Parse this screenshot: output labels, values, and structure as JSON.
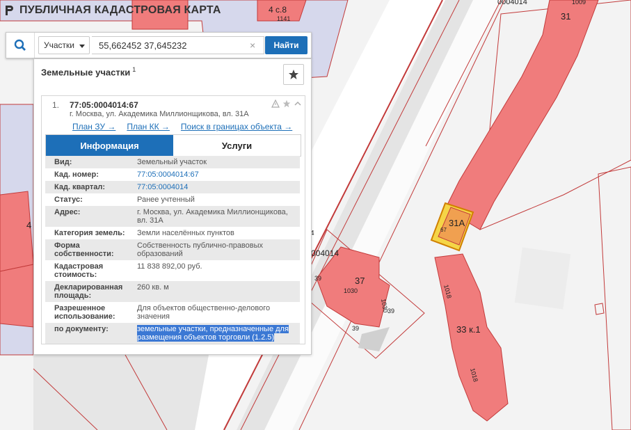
{
  "app": {
    "title": "ПУБЛИЧНАЯ КАДАСТРОВАЯ КАРТА"
  },
  "search": {
    "type_label": "Участки",
    "query": "55,662452 37,645232",
    "clear": "×",
    "button": "Найти"
  },
  "results": {
    "title": "Земельные участки",
    "count": "1",
    "item": {
      "number": "1.",
      "cadnum": "77:05:0004014:67",
      "address": "г. Москва, ул. Академика Миллионщикова, вл. 31А",
      "links": [
        "План ЗУ →",
        "План КК →",
        "Поиск в границах объекта →"
      ],
      "tabs": [
        "Информация",
        "Услуги"
      ],
      "fields": [
        {
          "k": "Вид:",
          "v": "Земельный участок"
        },
        {
          "k": "Кад. номер:",
          "v": "77:05:0004014:67"
        },
        {
          "k": "Кад. квартал:",
          "v": "77:05:0004014"
        },
        {
          "k": "Статус:",
          "v": "Ранее учтенный"
        },
        {
          "k": "Адрес:",
          "v": "г. Москва, ул. Академика Миллионщикова, вл. 31А"
        },
        {
          "k": "Категория земель:",
          "v": "Земли населённых пунктов"
        },
        {
          "k": "Форма собственности:",
          "v": "Собственность публично-правовых образований"
        },
        {
          "k": "Кадастровая стоимость:",
          "v": "11 838 892,00 руб."
        },
        {
          "k": "Декларированная площадь:",
          "v": "260 кв. м"
        },
        {
          "k": "Разрешенное использование:",
          "v": "Для объектов общественно-делового значения"
        },
        {
          "k": "по документу:",
          "v": "земельные участки, предназначенные для размещения объектов торговли (1.2.5)"
        }
      ]
    }
  },
  "map_labels": {
    "top_bldg": "4 с.8",
    "top_small": "1141",
    "top_quarter": "0004014",
    "b31": "31",
    "b1009": "1009",
    "b31a": "31А",
    "b67": "67",
    "quarter": "004014",
    "b37": "37",
    "b1030a": "1030",
    "b1030b": "1030",
    "n39a": "39",
    "n39b": "39",
    "n39c": "39",
    "b33": "33 к.1",
    "b1018a": "1018",
    "b1018b": "1018",
    "left4": "4",
    "edge4": "4"
  }
}
